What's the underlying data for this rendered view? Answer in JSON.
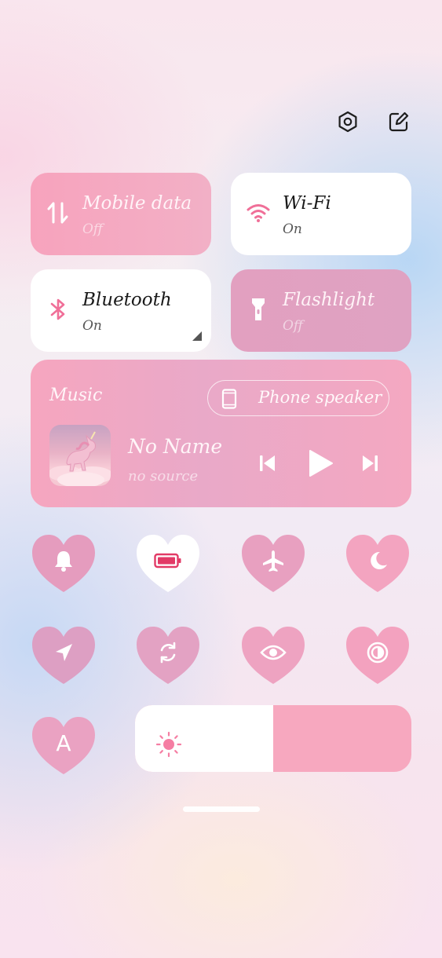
{
  "top_icons": {
    "settings": "settings-icon",
    "edit": "edit-icon"
  },
  "tiles": {
    "mobile_data": {
      "title": "Mobile data",
      "status": "Off",
      "icon": "mobile-data-icon"
    },
    "wifi": {
      "title": "Wi-Fi",
      "status": "On",
      "icon": "wifi-icon"
    },
    "bluetooth": {
      "title": "Bluetooth",
      "status": "On",
      "icon": "bluetooth-icon"
    },
    "flashlight": {
      "title": "Flashlight",
      "status": "Off",
      "icon": "flashlight-icon"
    }
  },
  "music": {
    "label": "Music",
    "output_device": "Phone speaker",
    "track_title": "No Name",
    "track_source": "no source",
    "controls": [
      "previous-icon",
      "play-icon",
      "next-icon"
    ]
  },
  "toggles": [
    {
      "icon": "bell-icon",
      "active": false
    },
    {
      "icon": "battery-saver-icon",
      "active": true
    },
    {
      "icon": "airplane-icon",
      "active": false
    },
    {
      "icon": "moon-icon",
      "active": false
    },
    {
      "icon": "location-icon",
      "active": false
    },
    {
      "icon": "auto-rotate-icon",
      "active": false
    },
    {
      "icon": "eye-comfort-icon",
      "active": false
    },
    {
      "icon": "dark-mode-icon",
      "active": false
    },
    {
      "icon": "auto-brightness-icon",
      "active": false
    }
  ],
  "auto_brightness_label": "A",
  "brightness": {
    "level_percent": 50,
    "icon": "sun-icon"
  },
  "colors": {
    "accent_pink": "#f7a3bd",
    "mauve": "#e0a1c1",
    "icon_pink": "#f06f98"
  }
}
